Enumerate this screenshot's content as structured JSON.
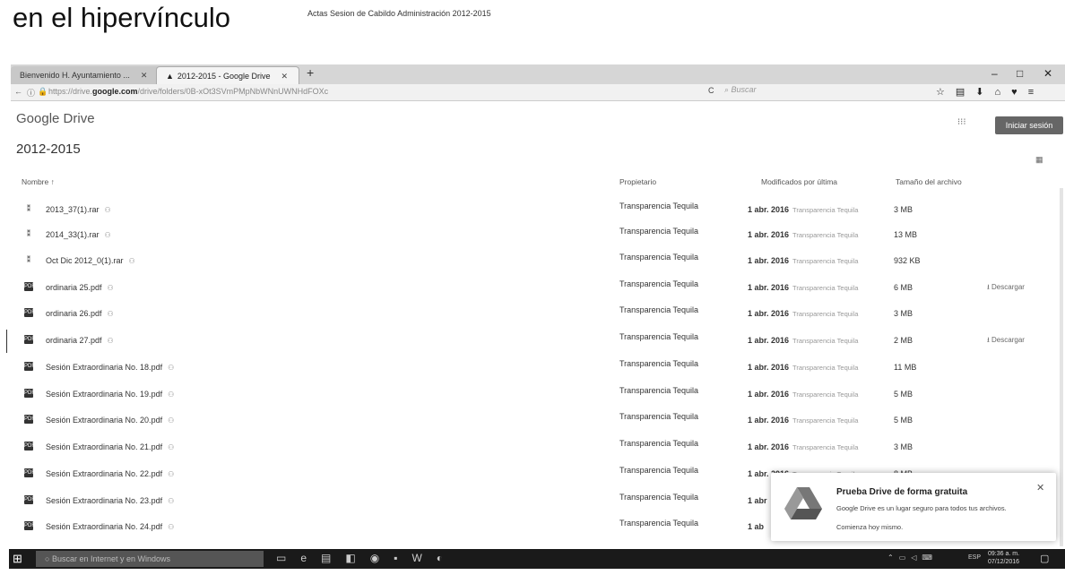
{
  "caption": {
    "large": "en el hipervínculo",
    "small": "Actas Sesion de Cabildo Administración 2012-2015"
  },
  "browser": {
    "tabs": [
      {
        "label": "Bienvenido H. Ayuntamiento ...",
        "active": false
      },
      {
        "label": "2012-2015 - Google Drive",
        "active": true
      }
    ],
    "url_prefix": "https://drive.",
    "url_domain": "google.com",
    "url_rest": "/drive/folders/0B-xOt3SVmPMpNbWNnUWNHdFOXc",
    "search_placeholder": "Buscar"
  },
  "drive": {
    "brand": "Google Drive",
    "signin_label": "Iniciar sesión",
    "folder_title": "2012-2015",
    "columns": {
      "name": "Nombre ↑",
      "owner": "Propietario",
      "modified": "Modificados por última",
      "size": "Tamaño del archivo"
    },
    "files": [
      {
        "name": "2013_37(1).rar",
        "type": "rar",
        "owner": "Transparencia Tequila",
        "date": "1 abr. 2016",
        "by": "Transparencia Tequila",
        "size": "3 MB",
        "download": ""
      },
      {
        "name": "2014_33(1).rar",
        "type": "rar",
        "owner": "Transparencia Tequila",
        "date": "1 abr. 2016",
        "by": "Transparencia Tequila",
        "size": "13 MB",
        "download": ""
      },
      {
        "name": "Oct Dic 2012_0(1).rar",
        "type": "rar",
        "owner": "Transparencia Tequila",
        "date": "1 abr. 2016",
        "by": "Transparencia Tequila",
        "size": "932 KB",
        "download": ""
      },
      {
        "name": "ordinaria 25.pdf",
        "type": "pdf",
        "owner": "Transparencia Tequila",
        "date": "1 abr. 2016",
        "by": "Transparencia Tequila",
        "size": "6 MB",
        "download": "Descargar"
      },
      {
        "name": "ordinaria 26.pdf",
        "type": "pdf",
        "owner": "Transparencia Tequila",
        "date": "1 abr. 2016",
        "by": "Transparencia Tequila",
        "size": "3 MB",
        "download": ""
      },
      {
        "name": "ordinaria 27.pdf",
        "type": "pdf",
        "owner": "Transparencia Tequila",
        "date": "1 abr. 2016",
        "by": "Transparencia Tequila",
        "size": "2 MB",
        "download": "Descargar"
      },
      {
        "name": "Sesión Extraordinaria No. 18.pdf",
        "type": "pdf",
        "owner": "Transparencia Tequila",
        "date": "1 abr. 2016",
        "by": "Transparencia Tequila",
        "size": "11 MB",
        "download": ""
      },
      {
        "name": "Sesión Extraordinaria No. 19.pdf",
        "type": "pdf",
        "owner": "Transparencia Tequila",
        "date": "1 abr. 2016",
        "by": "Transparencia Tequila",
        "size": "5 MB",
        "download": ""
      },
      {
        "name": "Sesión Extraordinaria No. 20.pdf",
        "type": "pdf",
        "owner": "Transparencia Tequila",
        "date": "1 abr. 2016",
        "by": "Transparencia Tequila",
        "size": "5 MB",
        "download": ""
      },
      {
        "name": "Sesión Extraordinaria No. 21.pdf",
        "type": "pdf",
        "owner": "Transparencia Tequila",
        "date": "1 abr. 2016",
        "by": "Transparencia Tequila",
        "size": "3 MB",
        "download": ""
      },
      {
        "name": "Sesión Extraordinaria No. 22.pdf",
        "type": "pdf",
        "owner": "Transparencia Tequila",
        "date": "1 abr. 2016",
        "by": "Transparencia Tequila",
        "size": "8 MB",
        "download": ""
      },
      {
        "name": "Sesión Extraordinaria No. 23.pdf",
        "type": "pdf",
        "owner": "Transparencia Tequila",
        "date": "1 abr",
        "by": "",
        "size": "",
        "download": ""
      },
      {
        "name": "Sesión Extraordinaria No. 24.pdf",
        "type": "pdf",
        "owner": "Transparencia Tequila",
        "date": "1 ab",
        "by": "",
        "size": "",
        "download": ""
      }
    ]
  },
  "promo": {
    "title": "Prueba Drive de forma gratuita",
    "description": "Google Drive es un lugar seguro para todos tus archivos.",
    "cta": "Comienza hoy mismo."
  },
  "taskbar": {
    "search_placeholder": "Buscar en Internet y en Windows",
    "lang": "ESP",
    "time": "09:36 a. m.",
    "date": "07/12/2016"
  },
  "colors": {
    "signin_bg": "#666666",
    "taskbar_bg": "#1a1a1a"
  }
}
